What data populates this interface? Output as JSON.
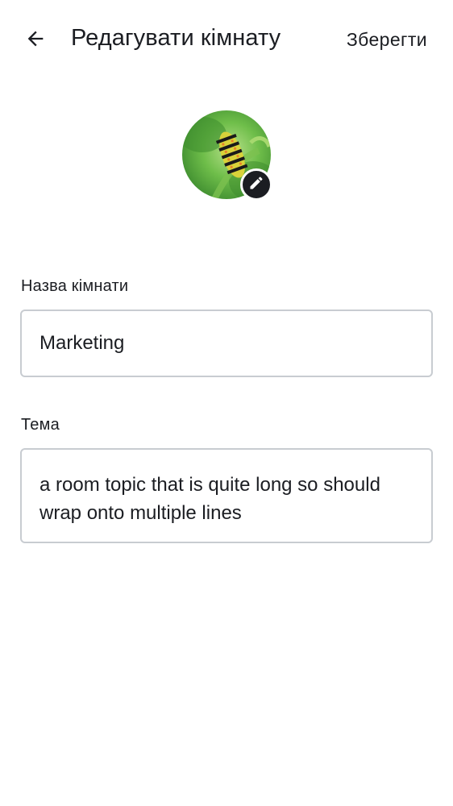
{
  "header": {
    "back_icon": "arrow-left-icon",
    "title": "Редагувати кімнату",
    "save_label": "Зберегти"
  },
  "avatar": {
    "image": "caterpillar-on-green-leaf",
    "edit_icon": "pencil-icon"
  },
  "form": {
    "name_label": "Назва кімнати",
    "name_value": "Marketing",
    "topic_label": "Тема",
    "topic_value": "a room topic that is quite long so should wrap onto multiple lines"
  },
  "colors": {
    "text": "#1b1d22",
    "border": "#c8ccd1",
    "badge": "#1b1d22",
    "background": "#ffffff"
  }
}
